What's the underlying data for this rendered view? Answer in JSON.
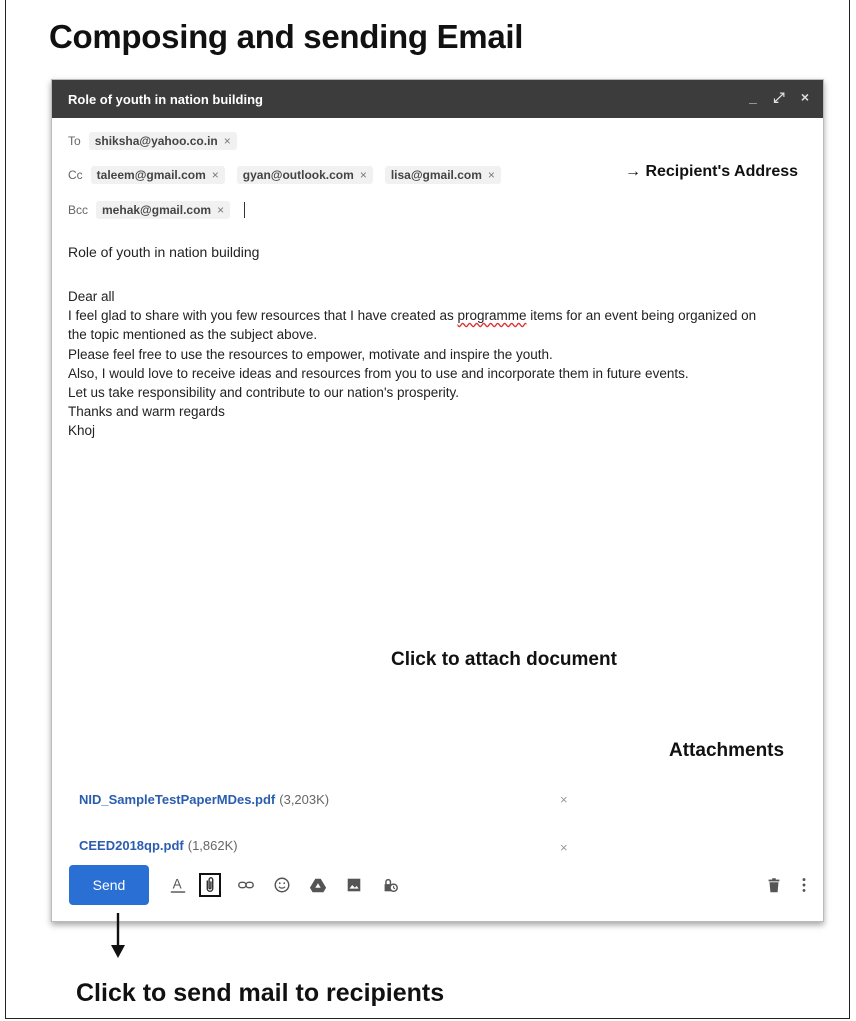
{
  "page": {
    "title": "Composing and sending Email",
    "annotations": {
      "recipients": "→ Recipient's Address",
      "attach_doc": "Click to attach document",
      "attachments": "Attachments",
      "send": "Click to send mail to recipients"
    }
  },
  "compose": {
    "window_title": "Role of youth in nation building",
    "window_buttons": {
      "minimize": "_",
      "expand": "⤢",
      "close": "×"
    },
    "to": {
      "label": "To",
      "recipients": [
        "shiksha@yahoo.co.in"
      ]
    },
    "cc": {
      "label": "Cc",
      "recipients": [
        "taleem@gmail.com",
        "gyan@outlook.com",
        "lisa@gmail.com"
      ]
    },
    "bcc": {
      "label": "Bcc",
      "recipients": [
        "mehak@gmail.com"
      ]
    },
    "chip_remove": "×",
    "subject": "Role of youth in nation building",
    "body": {
      "greeting": "Dear all",
      "line1_pre": "I feel glad to share with you few resources that I have created as ",
      "line1_flag": "programme",
      "line1_post": " items for an event being organized on",
      "line2": "the topic mentioned as the subject above.",
      "line3": "Please feel free to use the resources to empower, motivate and inspire the youth.",
      "line4": "Also, I would love to receive ideas and resources from you to use and incorporate them in future events.",
      "line5": "Let us take responsibility and contribute to our nation's prosperity.",
      "line6": "Thanks and warm regards",
      "signature": "Khoj"
    },
    "attachments": [
      {
        "name": "NID_SampleTestPaperMDes.pdf",
        "size": "(3,203K)"
      },
      {
        "name": "CEED2018qp.pdf",
        "size": "(1,862K)"
      }
    ],
    "attachment_remove": "×",
    "toolbar": {
      "send_label": "Send",
      "icons": [
        "format-text-icon",
        "attach-icon",
        "link-icon",
        "emoji-icon",
        "drive-icon",
        "photo-icon",
        "confidential-icon",
        "trash-icon",
        "more-icon"
      ],
      "accent": "#2a6fd4"
    }
  }
}
